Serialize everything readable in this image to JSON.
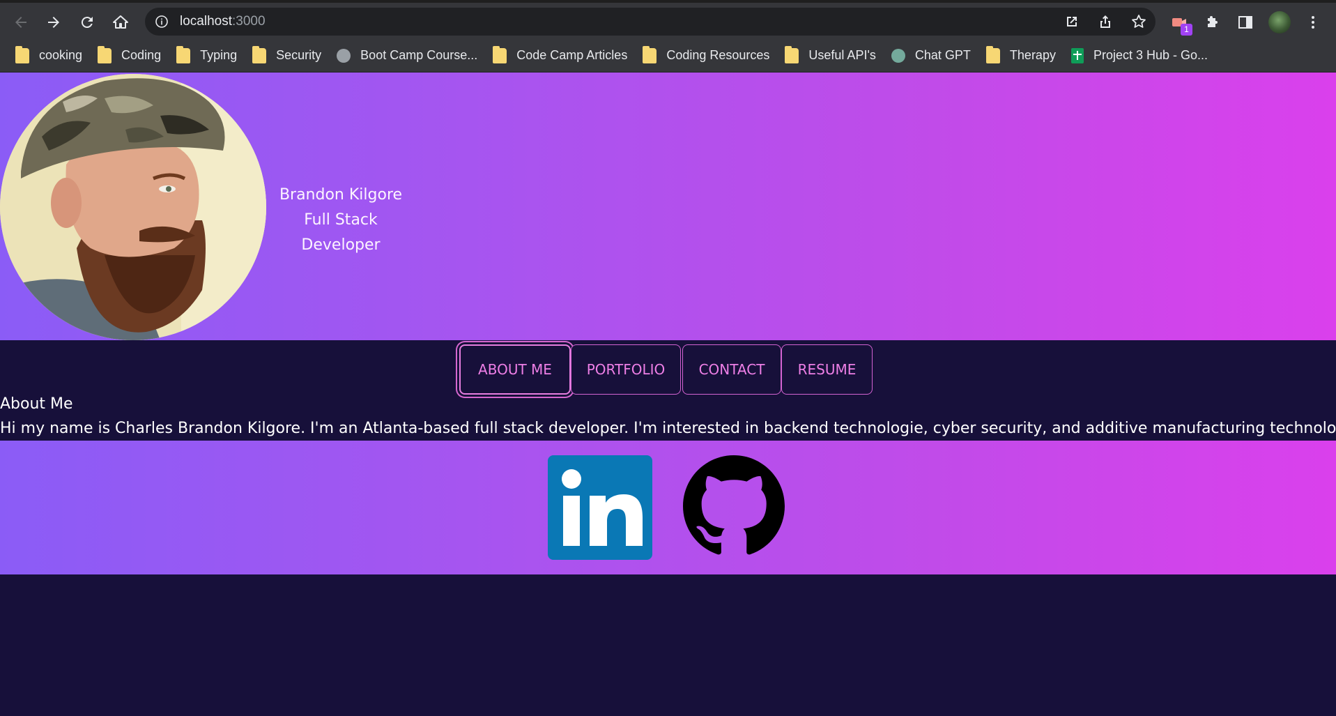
{
  "browser": {
    "url_host": "localhost",
    "url_port": ":3000",
    "extension_badge": "1"
  },
  "bookmarks": [
    {
      "label": "cooking",
      "icon": "folder-icon"
    },
    {
      "label": "Coding",
      "icon": "folder-icon"
    },
    {
      "label": "Typing",
      "icon": "folder-icon"
    },
    {
      "label": "Security",
      "icon": "folder-icon"
    },
    {
      "label": "Boot Camp Course...",
      "icon": "globe-icon"
    },
    {
      "label": "Code Camp Articles",
      "icon": "folder-icon"
    },
    {
      "label": "Coding Resources",
      "icon": "folder-icon"
    },
    {
      "label": "Useful API's",
      "icon": "folder-icon"
    },
    {
      "label": "Chat GPT",
      "icon": "chatgpt-icon"
    },
    {
      "label": "Therapy",
      "icon": "folder-icon"
    },
    {
      "label": "Project 3 Hub - Go...",
      "icon": "google-sheets-icon"
    }
  ],
  "header": {
    "name": "Brandon Kilgore",
    "role": "Full Stack Developer"
  },
  "nav": {
    "tabs": [
      {
        "label": "ABOUT ME",
        "active": true
      },
      {
        "label": "PORTFOLIO",
        "active": false
      },
      {
        "label": "CONTACT",
        "active": false
      },
      {
        "label": "RESUME",
        "active": false
      }
    ]
  },
  "about": {
    "title": "About Me",
    "body": "Hi my name is Charles Brandon Kilgore. I'm an Atlanta-based full stack developer. I'm interested in backend technologie, cyber security, and additive manufacturing technologies."
  },
  "footer": {
    "links": [
      {
        "icon": "linkedin-icon",
        "label": "in"
      },
      {
        "icon": "github-icon"
      }
    ]
  },
  "colors": {
    "page_bg": "#17103a",
    "gradient_start": "#8b5cf6",
    "gradient_end": "#da40ec",
    "tab_text": "#ee7fe6",
    "linkedin_blue": "#0a78b5"
  }
}
